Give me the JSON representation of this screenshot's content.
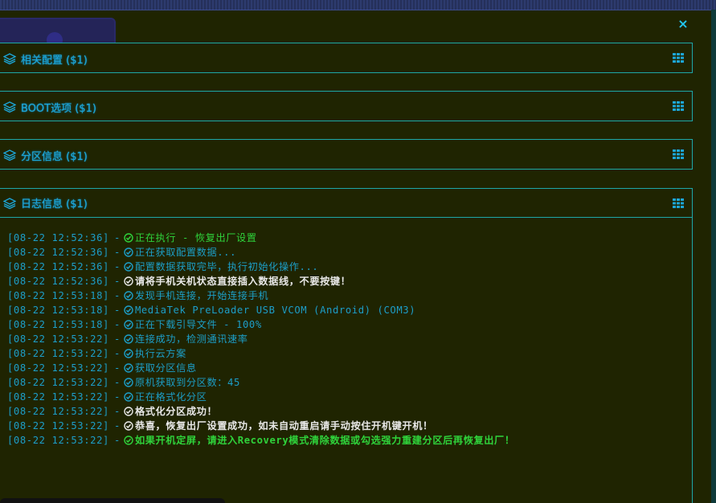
{
  "window": {
    "close_label": "×"
  },
  "panels": [
    {
      "title": "相关配置 ($1)"
    },
    {
      "title": "BOOT选项 ($1)"
    },
    {
      "title": "分区信息 ($1)"
    },
    {
      "title": "日志信息 ($1)"
    }
  ],
  "colors": {
    "accent": "#1ea7a8",
    "title": "#1ca6d8",
    "success": "#2fd33b",
    "info": "#1c9ec8",
    "warning": "#e8e8e8",
    "background": "#1f2401"
  },
  "icons": {
    "panel_left": "layers-icon",
    "panel_right": "grid-icon",
    "log_line": "check-circle-icon",
    "close": "close-icon"
  },
  "log": [
    {
      "time": "[08-22 12:52:36]",
      "sep": "-",
      "text": "正在执行 - 恢复出厂设置",
      "style": "green"
    },
    {
      "time": "[08-22 12:52:36]",
      "sep": "-",
      "text": "正在获取配置数据...",
      "style": "blue"
    },
    {
      "time": "[08-22 12:52:36]",
      "sep": "-",
      "text": "配置数据获取完毕，执行初始化操作...",
      "style": "blue"
    },
    {
      "time": "[08-22 12:52:36]",
      "sep": "-",
      "text": "请将手机关机状态直接插入数据线，不要按键！",
      "style": "white"
    },
    {
      "time": "[08-22 12:53:18]",
      "sep": "-",
      "text": "发现手机连接，开始连接手机",
      "style": "blue"
    },
    {
      "time": "[08-22 12:53:18]",
      "sep": "-",
      "text": "MediaTek PreLoader USB VCOM (Android) (COM3)",
      "style": "blue"
    },
    {
      "time": "[08-22 12:53:18]",
      "sep": "-",
      "text": "正在下载引导文件 - 100%",
      "style": "blue"
    },
    {
      "time": "[08-22 12:53:22]",
      "sep": "-",
      "text": "连接成功，检测通讯速率",
      "style": "blue"
    },
    {
      "time": "[08-22 12:53:22]",
      "sep": "-",
      "text": "执行云方案",
      "style": "blue"
    },
    {
      "time": "[08-22 12:53:22]",
      "sep": "-",
      "text": "获取分区信息",
      "style": "blue"
    },
    {
      "time": "[08-22 12:53:22]",
      "sep": "-",
      "text": "原机获取到分区数：45",
      "style": "blue"
    },
    {
      "time": "[08-22 12:53:22]",
      "sep": "-",
      "text": "正在格式化分区",
      "style": "blue"
    },
    {
      "time": "[08-22 12:53:22]",
      "sep": "-",
      "text": "格式化分区成功！",
      "style": "white"
    },
    {
      "time": "[08-22 12:53:22]",
      "sep": "-",
      "text": "恭喜，恢复出厂设置成功，如未自动重启请手动按住开机键开机！",
      "style": "white"
    },
    {
      "time": "[08-22 12:53:22]",
      "sep": "-",
      "text": "如果开机定屏，请进入Recovery模式清除数据或勾选强力重建分区后再恢复出厂！",
      "style": "green-bold"
    }
  ]
}
